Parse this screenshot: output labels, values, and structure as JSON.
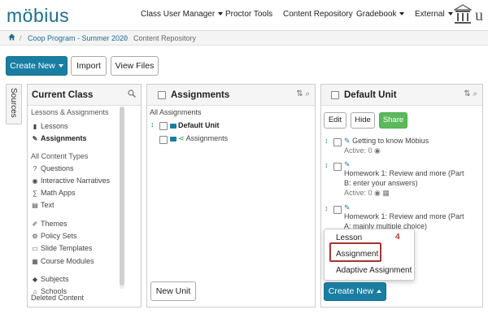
{
  "nav": {
    "logo": "möbius",
    "items": [
      "Class User Manager",
      "Proctor Tools",
      "Content Repository",
      "Gradebook",
      "External"
    ],
    "inst_letter": "u"
  },
  "breadcrumb": {
    "home_icon": "home-icon",
    "items": [
      "Coop Program - Summer 2020",
      "Content Repository"
    ]
  },
  "toolbar": {
    "create_new": "Create New",
    "import": "Import",
    "view_files": "View Files"
  },
  "sources_tab": "Sources",
  "current_class": {
    "title": "Current Class",
    "groups": [
      {
        "label": "Lessons & Assignments",
        "items": [
          {
            "icon": "book-icon",
            "label": "Lessons",
            "bold": false
          },
          {
            "icon": "pencil-icon",
            "label": "Assignments",
            "bold": true
          }
        ]
      },
      {
        "label": "All Content Types",
        "items": [
          {
            "icon": "question-icon",
            "label": "Questions",
            "bold": false
          },
          {
            "icon": "narrative-icon",
            "label": "Interactive Narratives",
            "bold": false
          },
          {
            "icon": "math-app-icon",
            "label": "Math Apps",
            "bold": false
          },
          {
            "icon": "text-icon",
            "label": "Text",
            "bold": false
          },
          {
            "icon": "themes-icon",
            "label": "Themes",
            "bold": false
          },
          {
            "icon": "policy-sets-icon",
            "label": "Policy Sets",
            "bold": false
          },
          {
            "icon": "slide-templates-icon",
            "label": "Slide Templates",
            "bold": false
          },
          {
            "icon": "course-modules-icon",
            "label": "Course Modules",
            "bold": false
          },
          {
            "icon": "subjects-icon",
            "label": "Subjects",
            "bold": false
          },
          {
            "icon": "schools-icon",
            "label": "Schools",
            "bold": false
          }
        ]
      }
    ],
    "deleted": "Deleted Content"
  },
  "assignments": {
    "title": "Assignments",
    "all_label": "All Assignments",
    "tree": [
      {
        "label": "Default Unit",
        "type": "folder",
        "bold": true
      },
      {
        "label": "Assignments",
        "type": "shared",
        "bold": false
      }
    ],
    "new_unit": "New Unit"
  },
  "default_unit": {
    "title": "Default Unit",
    "buttons": {
      "edit": "Edit",
      "hide": "Hide",
      "share": "Share"
    },
    "items": [
      {
        "title": "Getting to know Möbius",
        "status": "Active: 0"
      },
      {
        "title": "Homework 1: Review and more (Part B: enter your answers)",
        "status": "Active: 0"
      },
      {
        "title": "Homework 1: Review and more (Part A: mainly multiple choice)",
        "status": ""
      }
    ],
    "create_new": "Create New",
    "dropdown": [
      "Lesson",
      "Assignment",
      "Adaptive Assignment"
    ],
    "annotation_number": "4"
  }
}
